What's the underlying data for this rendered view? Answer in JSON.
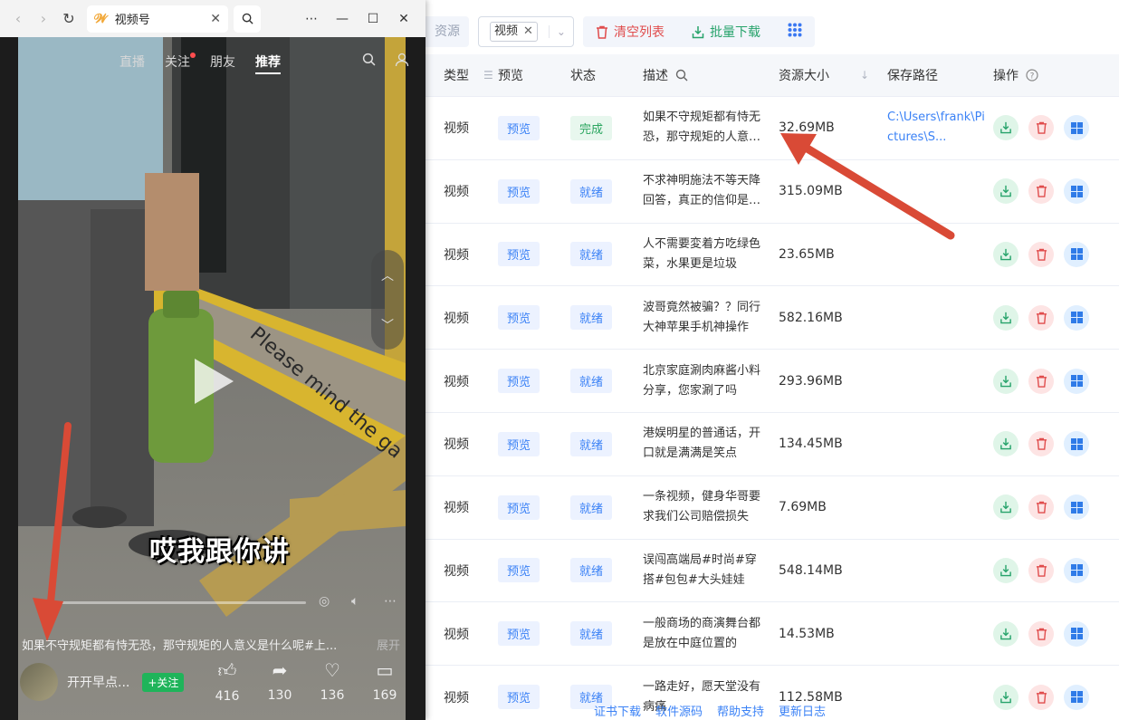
{
  "toolbar": {
    "source_label": "资源",
    "filter_tag": "视频",
    "filter_remove": "✕",
    "filter_arrow": "⌄",
    "clear_label": "清空列表",
    "batch_download_label": "批量下载",
    "grid_icon": "grid-icon"
  },
  "table": {
    "headers": {
      "type": "类型",
      "preview": "预览",
      "status": "状态",
      "desc": "描述",
      "size": "资源大小",
      "path": "保存路径",
      "ops": "操作"
    },
    "rows": [
      {
        "type": "视频",
        "preview": "预览",
        "status": "完成",
        "status_kind": "done",
        "desc": "如果不守规矩都有恃无恐，那守规矩的人意义是什么呢",
        "size": "32.69MB",
        "path": "C:\\Users\\frank\\Pictures\\S..."
      },
      {
        "type": "视频",
        "preview": "预览",
        "status": "就绪",
        "status_kind": "ready",
        "desc": "不求神明施法不等天降回答，真正的信仰是自己",
        "size": "315.09MB",
        "path": ""
      },
      {
        "type": "视频",
        "preview": "预览",
        "status": "就绪",
        "status_kind": "ready",
        "desc": "人不需要変着方吃绿色菜，水果更是垃圾",
        "size": "23.65MB",
        "path": ""
      },
      {
        "type": "视频",
        "preview": "预览",
        "status": "就绪",
        "status_kind": "ready",
        "desc": "波哥竟然被骗？？同行大神苹果手机神操作",
        "size": "582.16MB",
        "path": ""
      },
      {
        "type": "视频",
        "preview": "预览",
        "status": "就绪",
        "status_kind": "ready",
        "desc": "北京家庭涮肉麻酱小料分享，您家涮了吗",
        "size": "293.96MB",
        "path": ""
      },
      {
        "type": "视频",
        "preview": "预览",
        "status": "就绪",
        "status_kind": "ready",
        "desc": "港娱明星的普通话，开口就是满满是笑点",
        "size": "134.45MB",
        "path": ""
      },
      {
        "type": "视频",
        "preview": "预览",
        "status": "就绪",
        "status_kind": "ready",
        "desc": "一条视频，健身华哥要求我们公司赔偿损失",
        "size": "7.69MB",
        "path": ""
      },
      {
        "type": "视频",
        "preview": "预览",
        "status": "就绪",
        "status_kind": "ready",
        "desc": "误闯高端局#时尚#穿搭#包包#大头娃娃",
        "size": "548.14MB",
        "path": ""
      },
      {
        "type": "视频",
        "preview": "预览",
        "status": "就绪",
        "status_kind": "ready",
        "desc": "一般商场的商演舞台都是放在中庭位置的",
        "size": "14.53MB",
        "path": ""
      },
      {
        "type": "视频",
        "preview": "预览",
        "status": "就绪",
        "status_kind": "ready",
        "desc": "一路走好，愿天堂没有病痛",
        "size": "112.58MB",
        "path": ""
      }
    ]
  },
  "footer": {
    "links": [
      "证书下载",
      "软件源码",
      "帮助支持",
      "更新日志"
    ]
  },
  "popup": {
    "tab_title": "视频号",
    "nav_tabs": [
      "直播",
      "关注",
      "朋友",
      "推荐"
    ],
    "active_tab": "推荐",
    "caption": "哎我跟你讲",
    "description": "如果不守规矩都有恃无恐，那守规矩的人意义是什么呢#上...",
    "expand": "展开",
    "author": "开开早点...",
    "follow": "+关注",
    "likes": "416",
    "shares": "130",
    "favorites": "136",
    "comments": "169",
    "floor_text": "Please mind the ga"
  },
  "colors": {
    "accent_blue": "#3b82f6",
    "danger_red": "#e04c4c",
    "success_green": "#27a36b",
    "annotation_red": "#d94a36"
  }
}
